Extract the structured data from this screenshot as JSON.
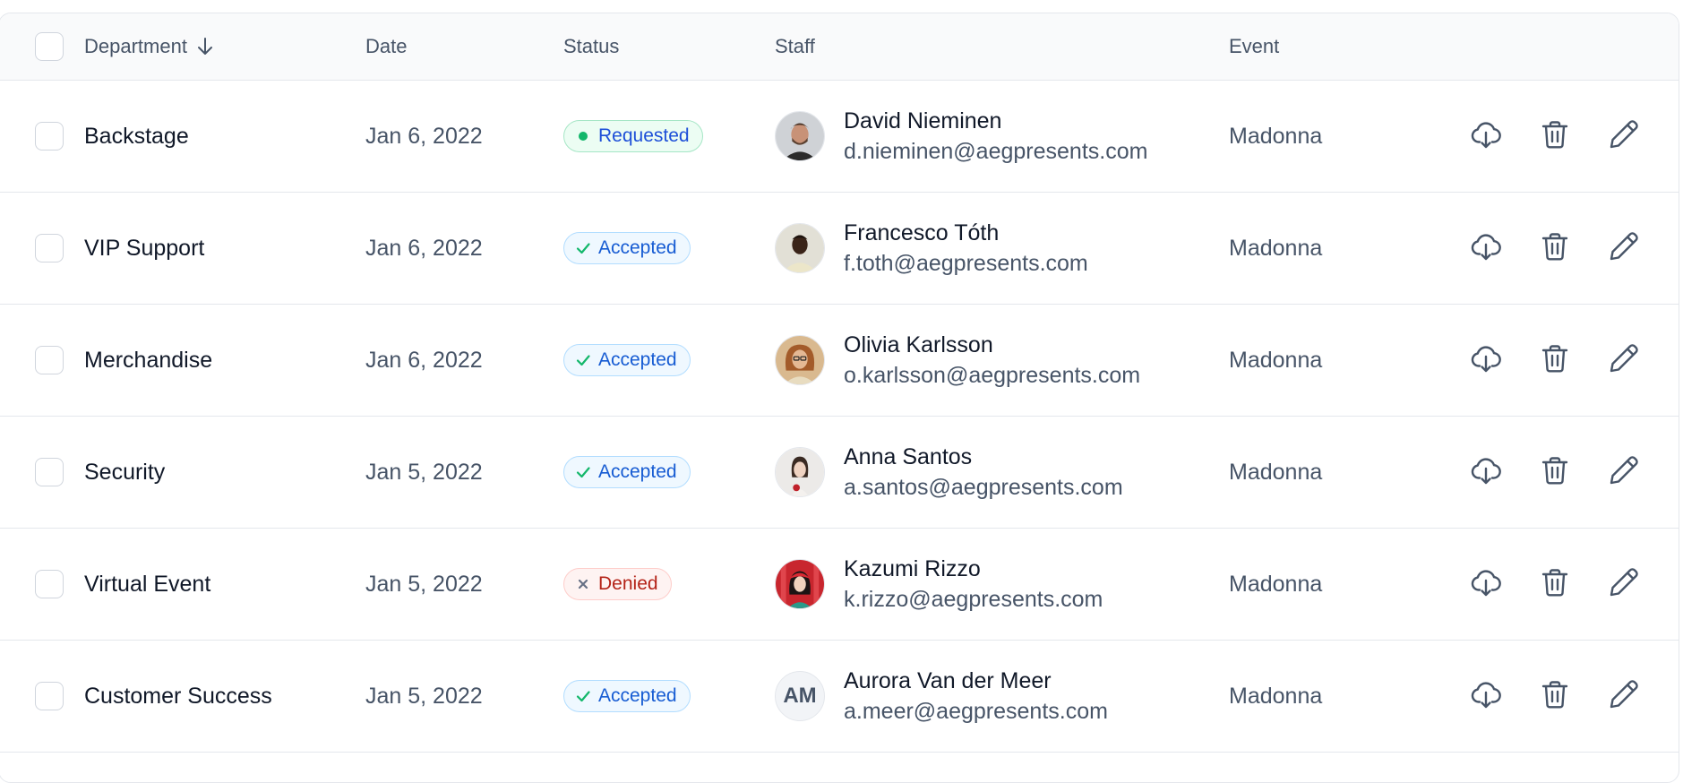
{
  "table": {
    "headers": {
      "department": "Department",
      "date": "Date",
      "status": "Status",
      "staff": "Staff",
      "event": "Event"
    },
    "rows": [
      {
        "department": "Backstage",
        "date": "Jan 6, 2022",
        "status": "Requested",
        "status_type": "requested",
        "staff_name": "David Nieminen",
        "staff_email": "d.nieminen@aegpresents.com",
        "event": "Madonna",
        "avatar_initials": ""
      },
      {
        "department": "VIP Support",
        "date": "Jan 6, 2022",
        "status": "Accepted",
        "status_type": "accepted",
        "staff_name": "Francesco Tóth",
        "staff_email": "f.toth@aegpresents.com",
        "event": "Madonna",
        "avatar_initials": ""
      },
      {
        "department": "Merchandise",
        "date": "Jan 6, 2022",
        "status": "Accepted",
        "status_type": "accepted",
        "staff_name": "Olivia Karlsson",
        "staff_email": "o.karlsson@aegpresents.com",
        "event": "Madonna",
        "avatar_initials": ""
      },
      {
        "department": "Security",
        "date": "Jan 5, 2022",
        "status": "Accepted",
        "status_type": "accepted",
        "staff_name": "Anna Santos",
        "staff_email": "a.santos@aegpresents.com",
        "event": "Madonna",
        "avatar_initials": ""
      },
      {
        "department": "Virtual Event",
        "date": "Jan 5, 2022",
        "status": "Denied",
        "status_type": "denied",
        "staff_name": "Kazumi Rizzo",
        "staff_email": "k.rizzo@aegpresents.com",
        "event": "Madonna",
        "avatar_initials": ""
      },
      {
        "department": "Customer Success",
        "date": "Jan 5, 2022",
        "status": "Accepted",
        "status_type": "accepted",
        "staff_name": "Aurora Van der Meer",
        "staff_email": "a.meer@aegpresents.com",
        "event": "Madonna",
        "avatar_initials": "AM"
      }
    ]
  },
  "colors": {
    "accepted": "#175cd3",
    "requested_dot": "#12b76a",
    "denied": "#b42318",
    "icon": "#475467"
  },
  "icons": {
    "sort": "arrow-down-icon",
    "download": "cloud-download-icon",
    "delete": "trash-icon",
    "edit": "pencil-icon"
  }
}
